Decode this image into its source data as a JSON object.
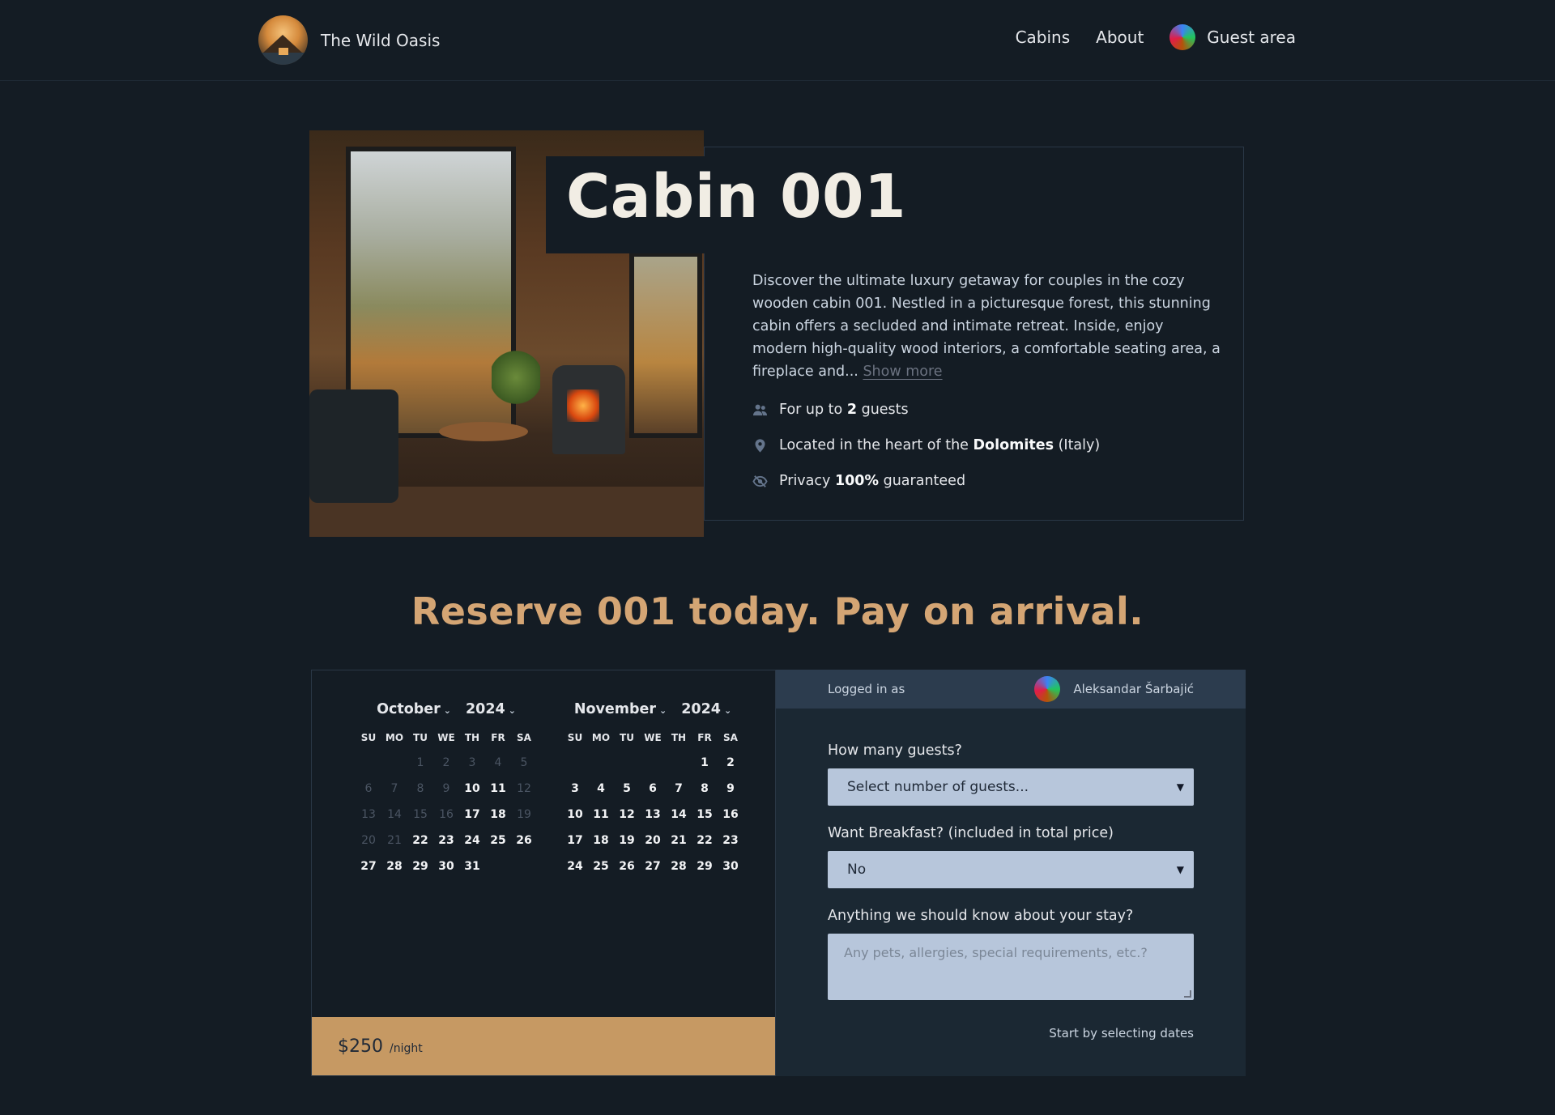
{
  "header": {
    "logo_text": "The Wild Oasis",
    "nav": {
      "cabins": "Cabins",
      "about": "About",
      "guest_area": "Guest area"
    }
  },
  "cabin": {
    "title": "Cabin 001",
    "description": "Discover the ultimate luxury getaway for couples in the cozy wooden cabin 001. Nestled in a picturesque forest, this stunning cabin offers a secluded and intimate retreat. Inside, enjoy modern high-quality wood interiors, a comfortable seating area, a fireplace and...",
    "show_more": "Show more",
    "features": {
      "guests_pre": "For up to",
      "guests_num": "2",
      "guests_post": "guests",
      "loc_pre": "Located in the heart of the",
      "loc_bold": "Dolomites",
      "loc_post": "(Italy)",
      "privacy_pre": "Privacy",
      "privacy_bold": "100%",
      "privacy_post": "guaranteed"
    }
  },
  "reserve": {
    "title": "Reserve 001 today. Pay on arrival."
  },
  "calendar": {
    "dow": [
      "SU",
      "MO",
      "TU",
      "WE",
      "TH",
      "FR",
      "SA"
    ],
    "months": [
      {
        "month": "October",
        "year": "2024",
        "lead": 2,
        "days": [
          1,
          2,
          3,
          4,
          5,
          6,
          7,
          8,
          9,
          10,
          11,
          12,
          13,
          14,
          15,
          16,
          17,
          18,
          19,
          20,
          21,
          22,
          23,
          24,
          25,
          26,
          27,
          28,
          29,
          30,
          31
        ],
        "dim": [
          1,
          2,
          3,
          4,
          5,
          6,
          7,
          8,
          9,
          12,
          13,
          14,
          15,
          16,
          19,
          20,
          21
        ]
      },
      {
        "month": "November",
        "year": "2024",
        "lead": 5,
        "days": [
          1,
          2,
          3,
          4,
          5,
          6,
          7,
          8,
          9,
          10,
          11,
          12,
          13,
          14,
          15,
          16,
          17,
          18,
          19,
          20,
          21,
          22,
          23,
          24,
          25,
          26,
          27,
          28,
          29,
          30
        ],
        "dim": []
      }
    ],
    "price": "$250",
    "per_night": "/night"
  },
  "form": {
    "logged_in_as": "Logged in as",
    "user_name": "Aleksandar Šarbajić",
    "guests_label": "How many guests?",
    "guests_value": "Select number of guests...",
    "breakfast_label": "Want Breakfast? (included in total price)",
    "breakfast_value": "No",
    "notes_label": "Anything we should know about your stay?",
    "notes_placeholder": "Any pets, allergies, special requirements, etc.?",
    "start_text": "Start by selecting dates"
  }
}
